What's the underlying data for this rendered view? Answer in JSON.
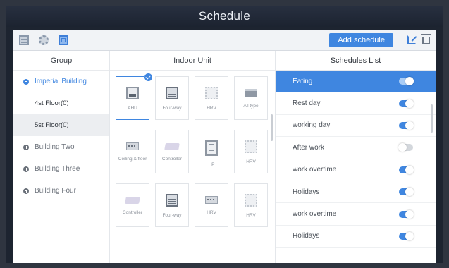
{
  "window": {
    "title": "Schedule"
  },
  "toolbar": {
    "add_schedule_label": "Add schedule",
    "icons": [
      "list-view-icon",
      "settings-icon",
      "grid-view-icon",
      "edit-icon",
      "delete-icon"
    ]
  },
  "group_panel": {
    "header": "Group",
    "buildings": [
      {
        "name": "Imperial Building",
        "state": "expanded",
        "floors": [
          "4st Floor(0)",
          "5st Floor(0)"
        ],
        "selected_floor": "5st Floor(0)"
      },
      {
        "name": "Building Two",
        "state": "collapsed"
      },
      {
        "name": "Building Three",
        "state": "collapsed"
      },
      {
        "name": "Building Four",
        "state": "collapsed"
      }
    ]
  },
  "unit_panel": {
    "header": "Indoor Unit",
    "units": [
      {
        "label": "AHU",
        "icon": "ahu-icon",
        "selected": true
      },
      {
        "label": "Four-way",
        "icon": "four-way-icon"
      },
      {
        "label": "HRV",
        "icon": "hrv-icon"
      },
      {
        "label": "All type",
        "icon": "all-type-icon"
      },
      {
        "label": "Ceiling & floor",
        "icon": "ceiling-floor-icon"
      },
      {
        "label": "Controller",
        "icon": "controller-icon"
      },
      {
        "label": "HP",
        "icon": "hp-icon"
      },
      {
        "label": "HRV",
        "icon": "hrv-icon"
      },
      {
        "label": "Controller",
        "icon": "controller-icon"
      },
      {
        "label": "Four-way",
        "icon": "four-way-icon"
      },
      {
        "label": "HRV",
        "icon": "hrv-icon"
      },
      {
        "label": "HRV",
        "icon": "hrv-icon"
      }
    ]
  },
  "schedule_panel": {
    "header": "Schedules List",
    "items": [
      {
        "name": "Eating",
        "enabled": true,
        "active": true
      },
      {
        "name": "Rest day",
        "enabled": true
      },
      {
        "name": "working day",
        "enabled": true
      },
      {
        "name": "After work",
        "enabled": false
      },
      {
        "name": "work overtime",
        "enabled": true
      },
      {
        "name": "Holidays",
        "enabled": true
      },
      {
        "name": "work overtime",
        "enabled": true
      },
      {
        "name": "Holidays",
        "enabled": true
      }
    ]
  },
  "colors": {
    "accent": "#3f86e0",
    "titlebar": "#1d2430"
  }
}
